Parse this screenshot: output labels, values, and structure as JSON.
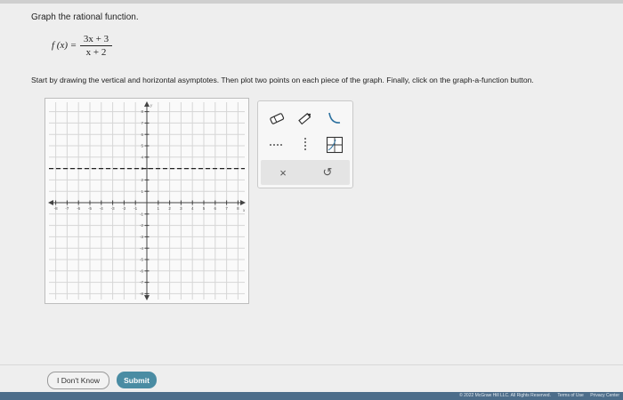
{
  "question": {
    "prompt": "Graph the rational function.",
    "function_lhs": "f (x) =",
    "numerator": "3x + 3",
    "denominator": "x + 2",
    "instructions": "Start by drawing the vertical and horizontal asymptotes. Then plot two points on each piece of the graph. Finally, click on the graph-a-function button."
  },
  "graph": {
    "x_axis_label": "x",
    "y_axis_label": "y",
    "x_range": [
      -8,
      8
    ],
    "y_range": [
      -8,
      8
    ],
    "x_tick_labels": [
      "-8",
      "-7",
      "-6",
      "-5",
      "-4",
      "-3",
      "-2",
      "-1",
      "",
      "1",
      "2",
      "3",
      "4",
      "5",
      "6",
      "7",
      "8"
    ],
    "y_tick_labels": [
      "8",
      "7",
      "6",
      "5",
      "4",
      "3",
      "2",
      "1",
      "",
      "-1",
      "-2",
      "-3",
      "-4",
      "-5",
      "-6",
      "-7",
      "-8"
    ],
    "horizontal_asymptote": 3,
    "grid": true,
    "accent": "#222222"
  },
  "tools": {
    "row1": [
      "eraser-icon",
      "pencil-icon",
      "curve-icon"
    ],
    "row2": [
      "horizontal-dashed-line-icon",
      "vertical-dashed-line-icon",
      "graph-a-function-icon"
    ],
    "clear_symbol": "×",
    "undo_symbol": "↺"
  },
  "actions": {
    "dont_know": "I Don't Know",
    "submit": "Submit",
    "submit_color": "#4a8ca3"
  },
  "footer": {
    "copyright": "© 2022 McGraw Hill LLC. All Rights Reserved.",
    "terms": "Terms of Use",
    "privacy": "Privacy Center"
  }
}
